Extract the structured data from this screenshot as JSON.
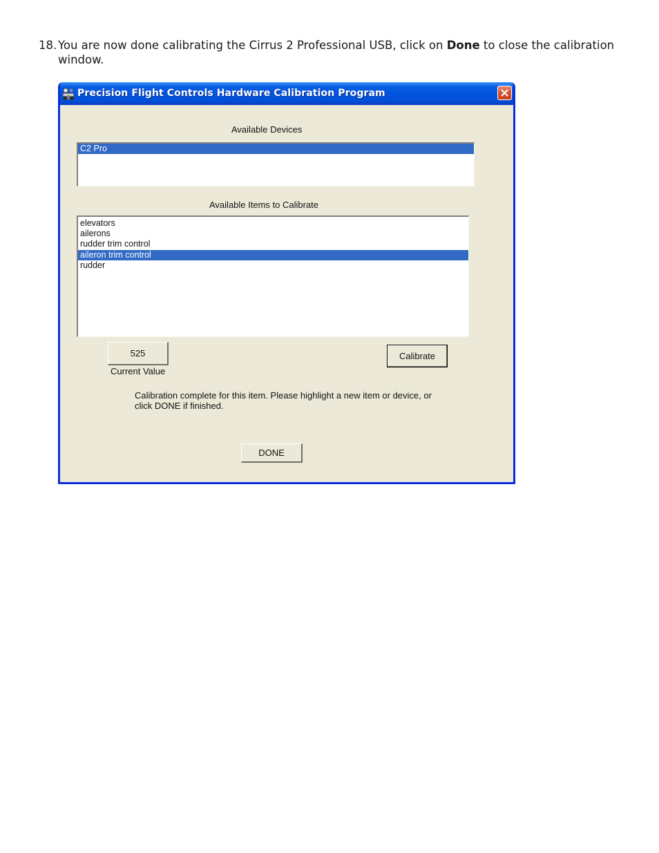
{
  "instruction": {
    "number": "18.",
    "text_before": "You are now done calibrating the Cirrus 2 Professional USB, click on ",
    "bold_word": "Done",
    "text_after": " to close the calibration window."
  },
  "window": {
    "title": "Precision Flight Controls Hardware Calibration Program",
    "app_icon": "pfc-app-icon",
    "close_icon": "close-icon"
  },
  "devices": {
    "label": "Available Devices",
    "items": [
      "C2 Pro"
    ],
    "selected_index": 0
  },
  "calibrate_items": {
    "label": "Available Items to Calibrate",
    "items": [
      "elevators",
      "ailerons",
      "rudder trim control",
      "aileron trim control",
      "rudder"
    ],
    "selected_index": 3
  },
  "current_value": {
    "value": "525",
    "label": "Current Value"
  },
  "buttons": {
    "calibrate_label": "Calibrate",
    "done_label": "DONE"
  },
  "status_message": "Calibration complete for this item. Please highlight a new item or device, or click DONE if finished.",
  "colors": {
    "titlebar": "#0254e0",
    "window_frame": "#0831d9",
    "dialog_bg": "#ece9d8",
    "selection": "#316ac5",
    "close_button": "#d8552f"
  }
}
